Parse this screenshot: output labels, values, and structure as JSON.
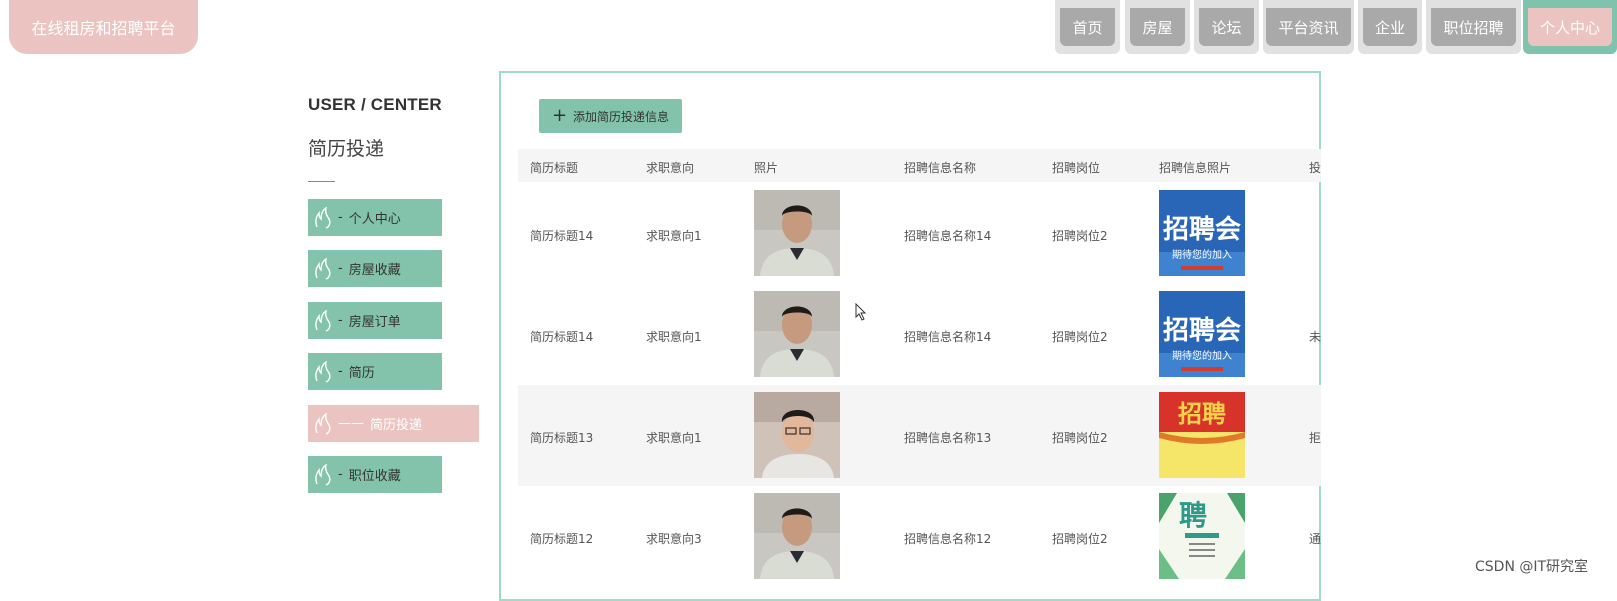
{
  "header": {
    "logo": "在线租房和招聘平台",
    "nav": [
      "首页",
      "房屋",
      "论坛",
      "平台资讯",
      "企业",
      "职位招聘",
      "个人中心"
    ],
    "active_nav": "个人中心"
  },
  "sidebar": {
    "title": "USER / CENTER",
    "subtitle": "简历投递",
    "items": [
      {
        "label": "个人中心",
        "prefix": "-"
      },
      {
        "label": "房屋收藏",
        "prefix": "-"
      },
      {
        "label": "房屋订单",
        "prefix": "-"
      },
      {
        "label": "简历",
        "prefix": "-"
      },
      {
        "label": "简历投递",
        "prefix": "——"
      },
      {
        "label": "职位收藏",
        "prefix": "-"
      }
    ]
  },
  "toolbar": {
    "add_label": "添加简历投递信息",
    "add_icon": "plus-icon"
  },
  "table": {
    "headers": [
      "简历标题",
      "求职意向",
      "照片",
      "招聘信息名称",
      "招聘岗位",
      "招聘信息照片",
      "投"
    ],
    "rows": [
      {
        "title": "简历标题14",
        "intent": "求职意向1",
        "name": "招聘信息名称14",
        "post": "招聘岗位2",
        "status": ""
      },
      {
        "title": "简历标题14",
        "intent": "求职意向1",
        "name": "招聘信息名称14",
        "post": "招聘岗位2",
        "status": "未"
      },
      {
        "title": "简历标题13",
        "intent": "求职意向1",
        "name": "招聘信息名称13",
        "post": "招聘岗位2",
        "status": "拒"
      },
      {
        "title": "简历标题12",
        "intent": "求职意向3",
        "name": "招聘信息名称12",
        "post": "招聘岗位2",
        "status": "通"
      }
    ],
    "poster_texts": [
      "招聘会",
      "期待您的加入",
      "招聘会",
      "期待您的加入",
      "招聘",
      "聘"
    ]
  },
  "watermark": "CSDN @IT研究室",
  "colors": {
    "accent_green": "#83c3ac",
    "accent_pink": "#ebc4c1",
    "nav_gray": "#a9a9a9",
    "panel_border": "#9fdcc8"
  }
}
